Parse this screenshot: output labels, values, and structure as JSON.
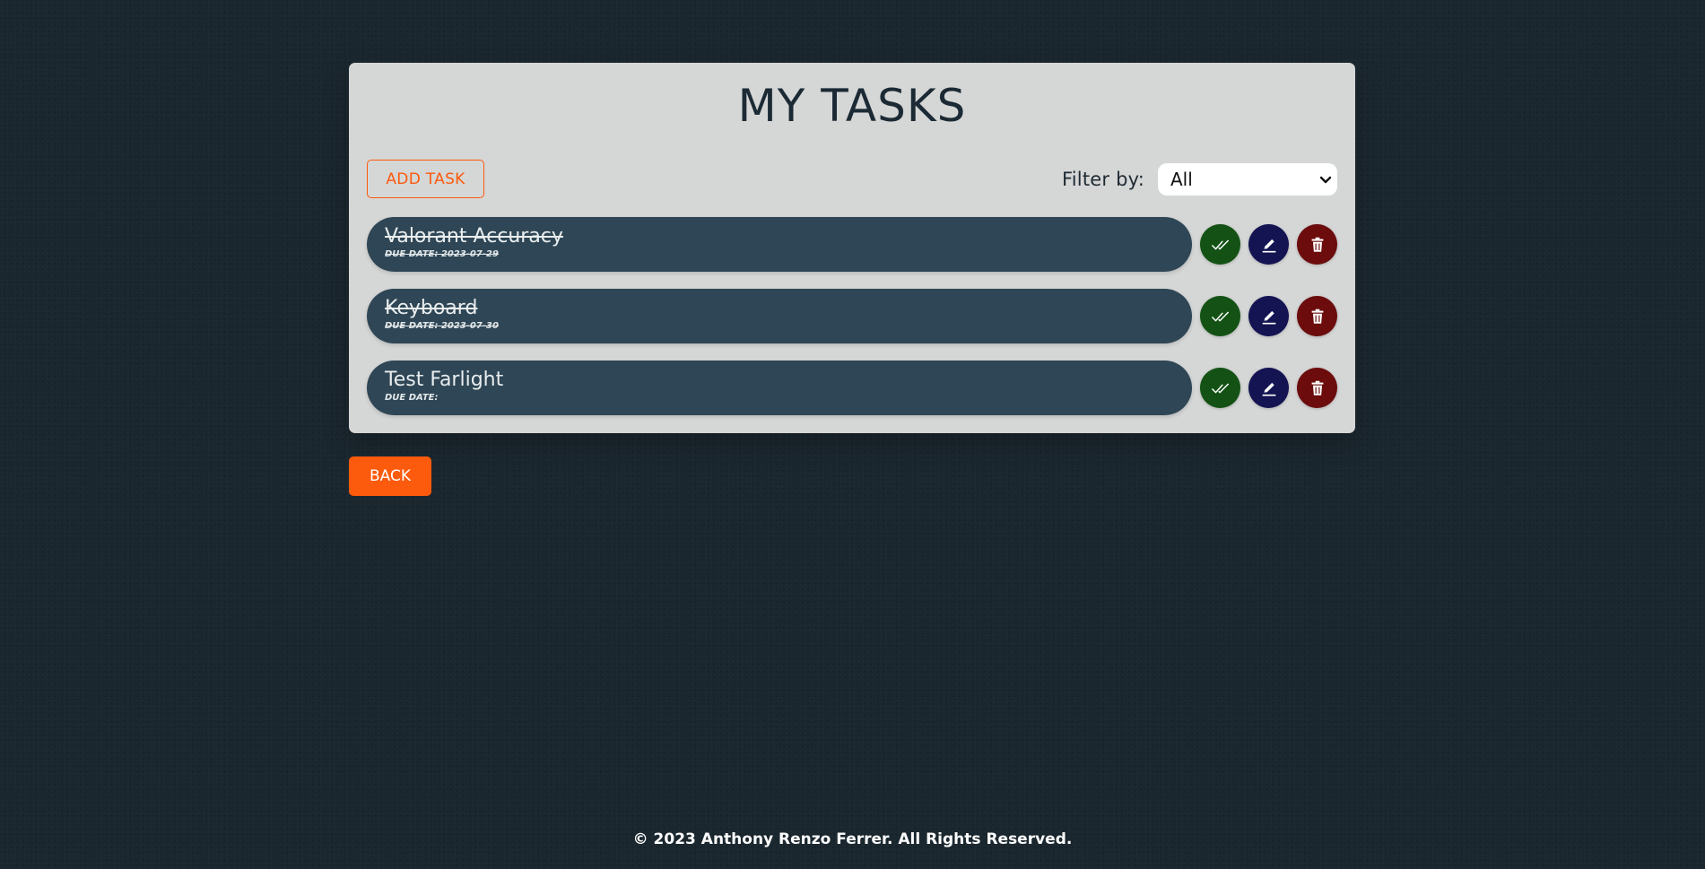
{
  "page": {
    "title": "MY TASKS"
  },
  "toolbar": {
    "add_label": "ADD TASK",
    "filter_label": "Filter by:",
    "filter_value": "All"
  },
  "tasks": [
    {
      "title": "Valorant Accuracy",
      "due": "DUE DATE: 2023-07-29",
      "completed": true
    },
    {
      "title": "Keyboard",
      "due": "DUE DATE: 2023-07-30",
      "completed": true
    },
    {
      "title": "Test Farlight",
      "due": "DUE DATE:",
      "completed": false
    }
  ],
  "actions": {
    "complete_icon": "double-check-icon",
    "edit_icon": "pencil-icon",
    "delete_icon": "trash-icon"
  },
  "back_label": "BACK",
  "footer": {
    "text": "© 2023 Anthony Renzo Ferrer. All Rights Reserved."
  },
  "colors": {
    "background": "#1b272f",
    "panel": "#d5d6d6",
    "accent": "#fc5a0c",
    "task_pill": "#2e4655",
    "complete": "#135214",
    "edit": "#141453",
    "delete": "#6c0c0c"
  }
}
